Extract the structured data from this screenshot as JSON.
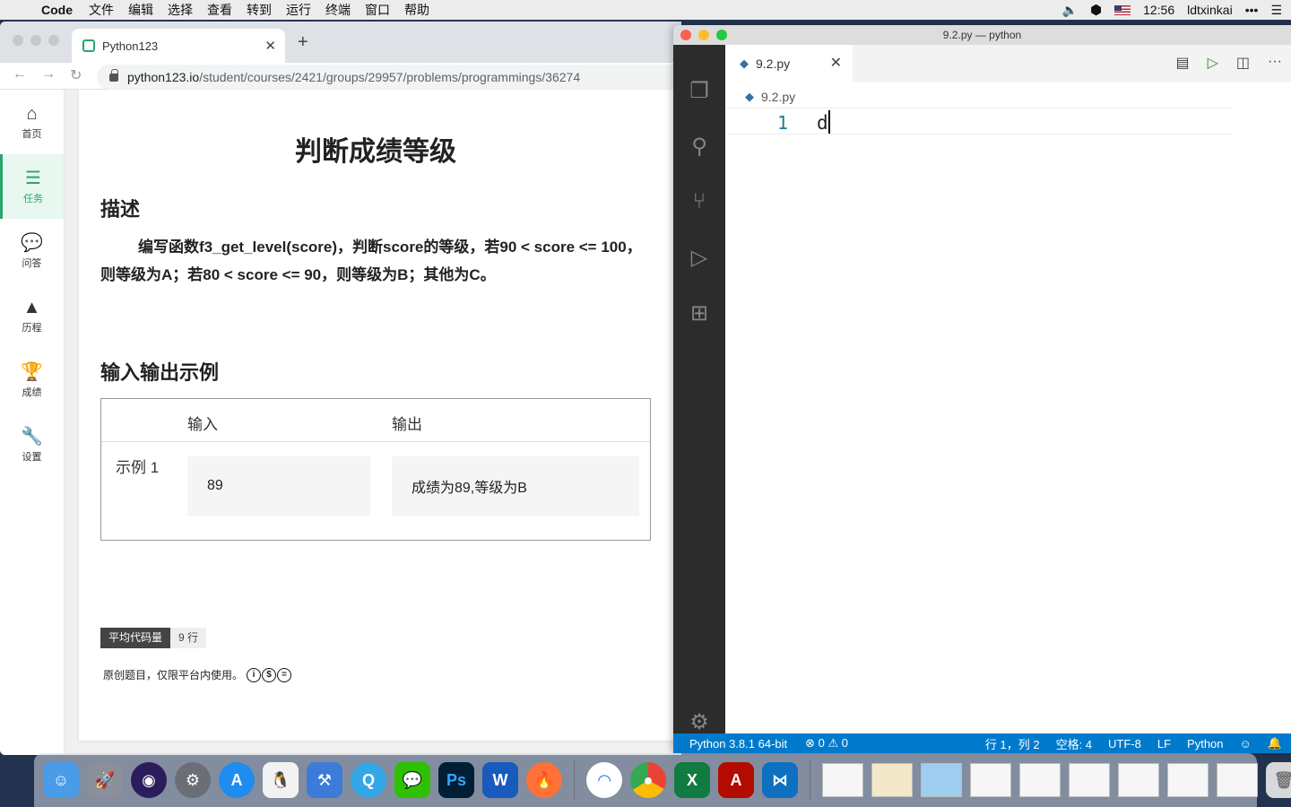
{
  "menubar": {
    "app_name": "Code",
    "menus": [
      "文件",
      "编辑",
      "选择",
      "查看",
      "转到",
      "运行",
      "终端",
      "窗口",
      "帮助"
    ],
    "time": "12:56",
    "user": "ldtxinkai"
  },
  "browser": {
    "tab_title": "Python123",
    "url_host": "python123.io",
    "url_path": "/student/courses/2421/groups/29957/problems/programmings/36274"
  },
  "sidebar": {
    "items": [
      {
        "label": "首页",
        "icon": "home-icon"
      },
      {
        "label": "任务",
        "icon": "tasks-icon"
      },
      {
        "label": "问答",
        "icon": "chat-icon"
      },
      {
        "label": "历程",
        "icon": "tree-icon"
      },
      {
        "label": "成绩",
        "icon": "trophy-icon"
      },
      {
        "label": "设置",
        "icon": "wrench-icon"
      }
    ],
    "active": "任务"
  },
  "problem": {
    "title": "判断成绩等级",
    "desc_heading": "描述",
    "description": "编写函数f3_get_level(score)，判断score的等级，若90 < score <= 100，则等级为A；若80 < score <= 90，则等级为B；其他为C。",
    "io_heading": "输入输出示例",
    "io_headers": {
      "input": "输入",
      "output": "输出"
    },
    "examples": [
      {
        "label": "示例 1",
        "input": "89",
        "output": "成绩为89,等级为B"
      }
    ],
    "avg_code_label": "平均代码量",
    "avg_code_value": "9 行",
    "copyright": "原创题目，仅限平台内使用。"
  },
  "vscode": {
    "window_title": "9.2.py — python",
    "tab_label": "9.2.py",
    "breadcrumb": "9.2.py",
    "line_number": "1",
    "code_text": "d",
    "status": {
      "interpreter": "Python 3.8.1 64-bit",
      "errors": "0",
      "warnings": "0",
      "position": "行 1，列 2",
      "spaces": "空格: 4",
      "encoding": "UTF-8",
      "eol": "LF",
      "language": "Python"
    }
  },
  "colors": {
    "accent_green": "#2aa56c",
    "vscode_blue": "#007acc"
  }
}
